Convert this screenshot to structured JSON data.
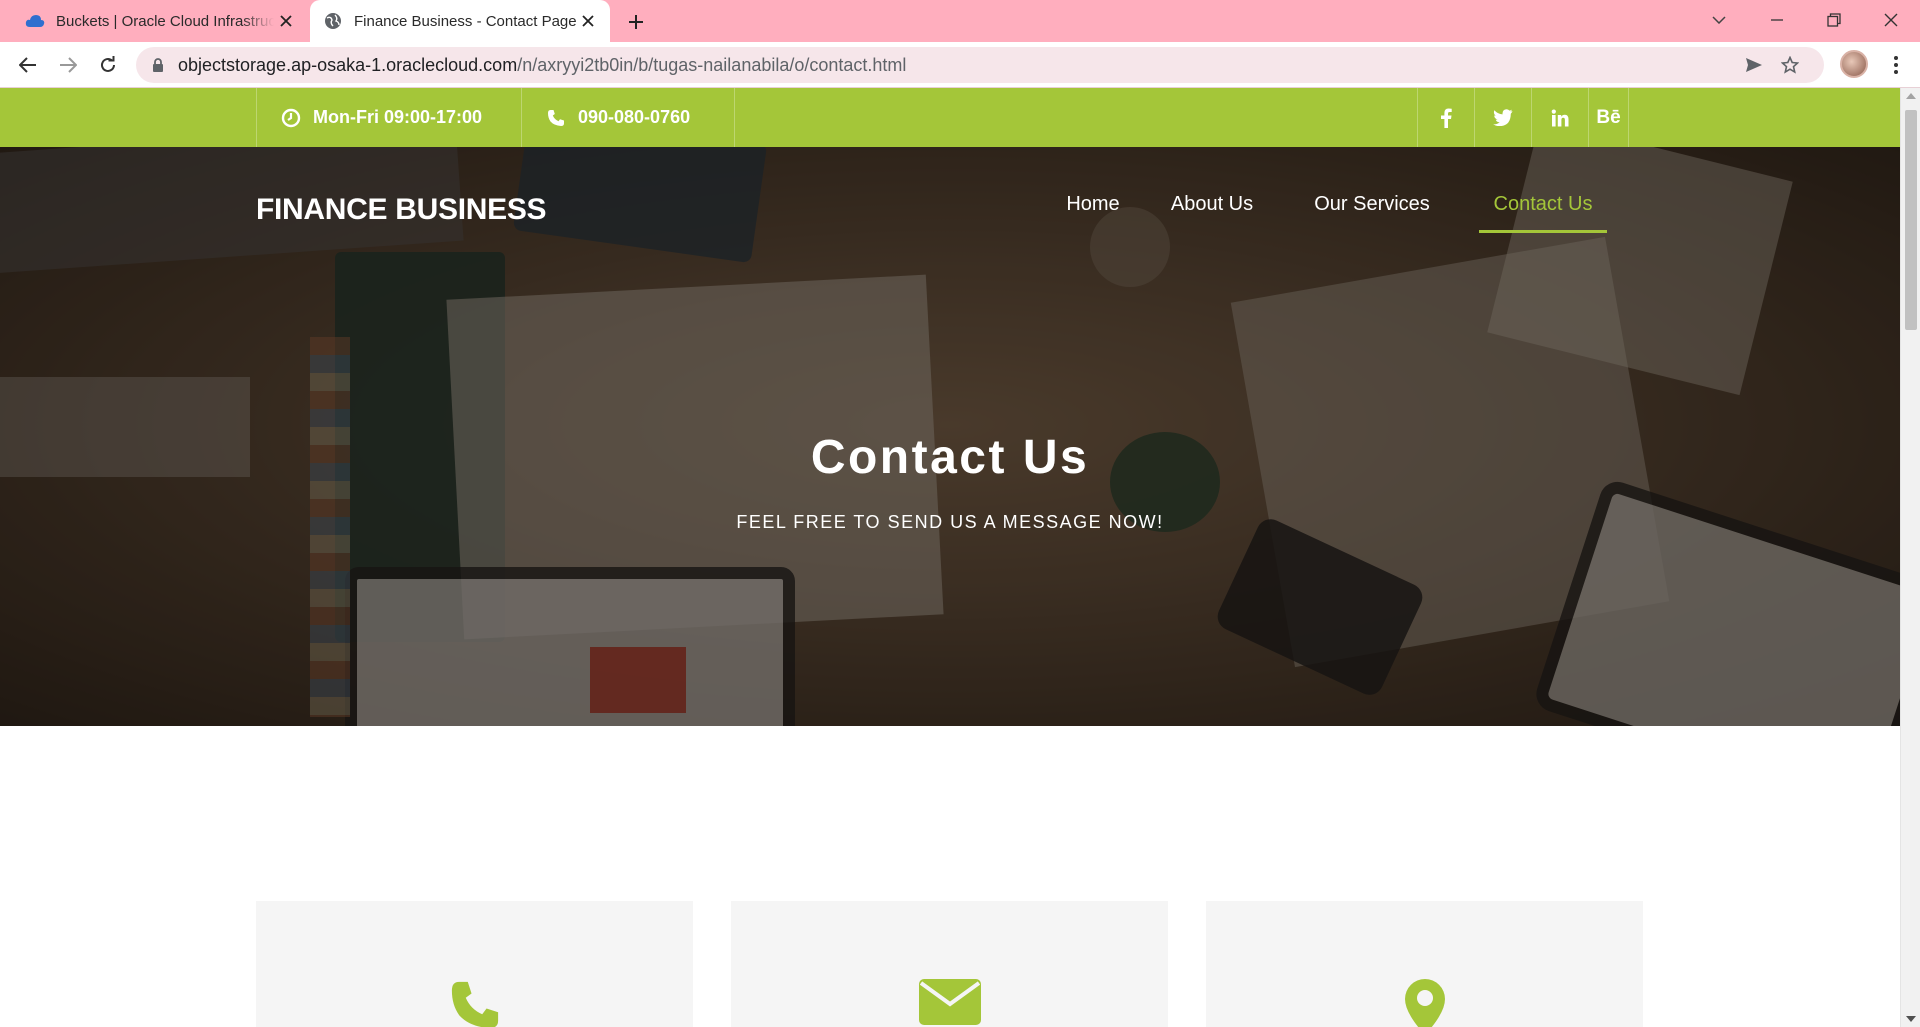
{
  "browser": {
    "tabs": [
      {
        "title": "Buckets | Oracle Cloud Infrastructure",
        "favicon": "cloud-icon"
      },
      {
        "title": "Finance Business - Contact Page",
        "favicon": "globe-icon"
      }
    ],
    "url_host": "objectstorage.ap-osaka-1.oraclecloud.com",
    "url_path": "/n/axryyi2tb0in/b/tugas-nailanabila/o/contact.html"
  },
  "infobar": {
    "hours": "Mon-Fri 09:00-17:00",
    "phone": "090-080-0760",
    "socials": [
      "f",
      "t",
      "in",
      "Bē"
    ]
  },
  "site": {
    "brand": "FINANCE BUSINESS",
    "menu": [
      "Home",
      "About Us",
      "Our Services",
      "Contact Us"
    ],
    "active_menu": "Contact Us"
  },
  "hero": {
    "title": "Contact Us",
    "subtitle": "FEEL FREE TO SEND US A MESSAGE NOW!"
  },
  "cards": [
    {
      "icon": "phone-icon"
    },
    {
      "icon": "envelope-icon"
    },
    {
      "icon": "map-marker-icon"
    }
  ],
  "colors": {
    "accent": "#a4c639",
    "tab_strip": "#ffaebe",
    "card_bg": "#f5f5f5"
  }
}
